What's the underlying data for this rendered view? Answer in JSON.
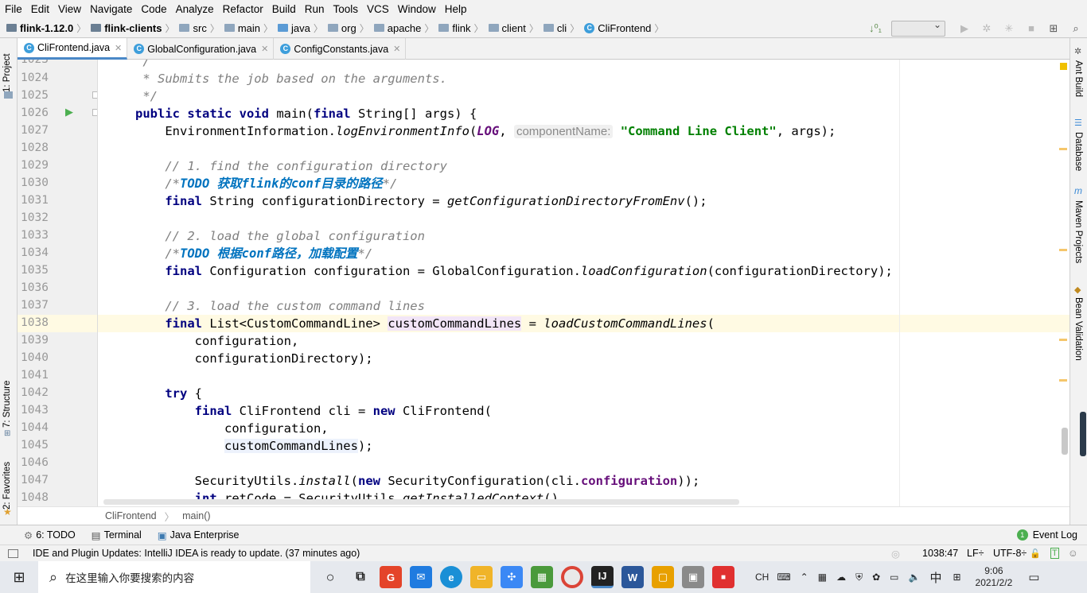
{
  "menu": [
    "File",
    "Edit",
    "View",
    "Navigate",
    "Code",
    "Analyze",
    "Refactor",
    "Build",
    "Run",
    "Tools",
    "VCS",
    "Window",
    "Help"
  ],
  "breadcrumbs": [
    "flink-1.12.0",
    "flink-clients",
    "src",
    "main",
    "java",
    "org",
    "apache",
    "flink",
    "client",
    "cli",
    "CliFrontend"
  ],
  "tabs": [
    {
      "label": "CliFrontend.java",
      "active": true
    },
    {
      "label": "GlobalConfiguration.java",
      "active": false
    },
    {
      "label": "ConfigConstants.java",
      "active": false
    }
  ],
  "left_panels": {
    "project": "1: Project",
    "structure": "7: Structure",
    "favorites": "2: Favorites"
  },
  "right_panels": {
    "ant": "Ant Build",
    "database": "Database",
    "maven": "Maven Projects",
    "bean": "Bean Validation"
  },
  "line_numbers": [
    "1023",
    "1024",
    "1025",
    "1026",
    "1027",
    "1028",
    "1029",
    "1030",
    "1031",
    "1032",
    "1033",
    "1034",
    "1035",
    "1036",
    "1037",
    "1038",
    "1039",
    "1040",
    "1041",
    "1042",
    "1043",
    "1044",
    "1045",
    "1046",
    "1047",
    "1048"
  ],
  "code": {
    "l1024": " * Submits the job based on the arguments.",
    "l1025": " */",
    "l1026_kw1": "public static void",
    "l1026_rest": " main(",
    "l1026_kw2": "final",
    "l1026_end": " String[] args) {",
    "l1027_a": "    EnvironmentInformation.",
    "l1027_m": "logEnvironmentInfo",
    "l1027_b": "(",
    "l1027_f": "LOG",
    "l1027_c": ", ",
    "l1027_hint": "componentName:",
    "l1027_s": "\"Command Line Client\"",
    "l1027_d": ", args);",
    "l1029": "    // 1. find the configuration directory",
    "l1030_a": "    /*",
    "l1030_t": "TODO 获取flink的conf目录的路径",
    "l1030_b": "*/",
    "l1031_k": "final",
    "l1031_a": " String configurationDirectory = ",
    "l1031_m": "getConfigurationDirectoryFromEnv",
    "l1031_b": "();",
    "l1033": "    // 2. load the global configuration",
    "l1034_a": "    /*",
    "l1034_t": "TODO 根据conf路径，加载配置",
    "l1034_b": "*/",
    "l1035_k": "final",
    "l1035_a": " Configuration configuration = GlobalConfiguration.",
    "l1035_m": "loadConfiguration",
    "l1035_b": "(configurationDirectory);",
    "l1037": "    // 3. load the custom command lines",
    "l1038_k": "final",
    "l1038_a": " List<CustomCommandLine> ",
    "l1038_v": "customCommandLines",
    "l1038_b": " = ",
    "l1038_m": "loadCustomCommandLines",
    "l1038_c": "(",
    "l1039": "        configuration,",
    "l1040": "        configurationDirectory);",
    "l1042_k": "try",
    "l1042_b": " {",
    "l1043_k1": "final",
    "l1043_a": " CliFrontend cli = ",
    "l1043_k2": "new",
    "l1043_b": " CliFrontend(",
    "l1044": "            configuration,",
    "l1045_v": "customCommandLines",
    "l1045_b": ");",
    "l1047_a": "        SecurityUtils.",
    "l1047_m": "install",
    "l1047_b": "(",
    "l1047_k": "new",
    "l1047_c": " SecurityConfiguration(cli.",
    "l1047_f": "configuration",
    "l1047_d": "));",
    "l1048_k": "int",
    "l1048_a": " retCode = SecurityUtils.",
    "l1048_m": "getInstalledContext",
    "l1048_b": "()"
  },
  "editor_breadcrumb": [
    "CliFrontend",
    "main()"
  ],
  "toolwindows": {
    "todo": "6: TODO",
    "terminal": "Terminal",
    "javaee": "Java Enterprise",
    "eventlog": "Event Log",
    "eventcount": "1"
  },
  "status": {
    "message": "IDE and Plugin Updates: IntelliJ IDEA is ready to update. (37 minutes ago)",
    "position": "1038:47",
    "lf": "LF÷",
    "encoding": "UTF-8÷"
  },
  "taskbar": {
    "search_placeholder": "在这里输入你要搜索的内容",
    "time": "9:06",
    "date": "2021/2/2",
    "ime1": "CH",
    "ime2": "中"
  },
  "colors": {
    "keyword": "#000080",
    "comment": "#808080",
    "todo": "#0073bf",
    "string": "#008000",
    "field": "#660e7a",
    "accent": "#4a88c7"
  }
}
